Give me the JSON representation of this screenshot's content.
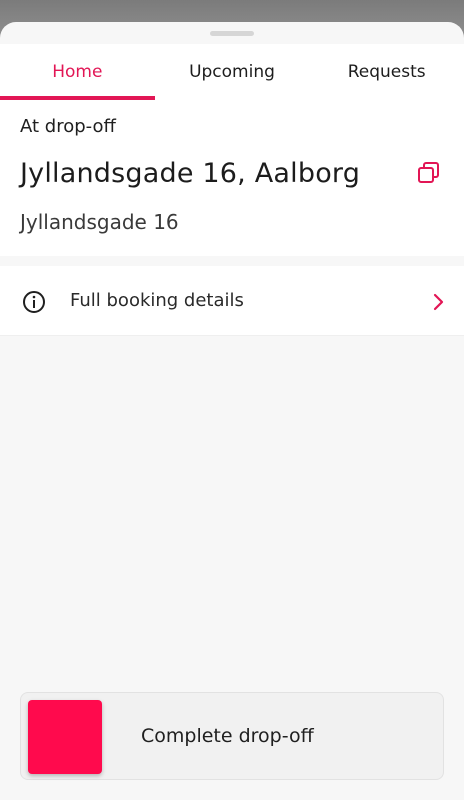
{
  "tabs": [
    {
      "label": "Home",
      "active": true
    },
    {
      "label": "Upcoming",
      "active": false
    },
    {
      "label": "Requests",
      "active": false
    }
  ],
  "stop": {
    "status": "At drop-off",
    "title": "Jyllandsgade 16, Aalborg",
    "subtitle": "Jyllandsgade 16"
  },
  "details": {
    "label": "Full booking details",
    "icon": "info-icon"
  },
  "action": {
    "label": "Complete drop-off"
  },
  "colors": {
    "accent": "#e21655",
    "swipe_handle": "#ff0a4d"
  }
}
